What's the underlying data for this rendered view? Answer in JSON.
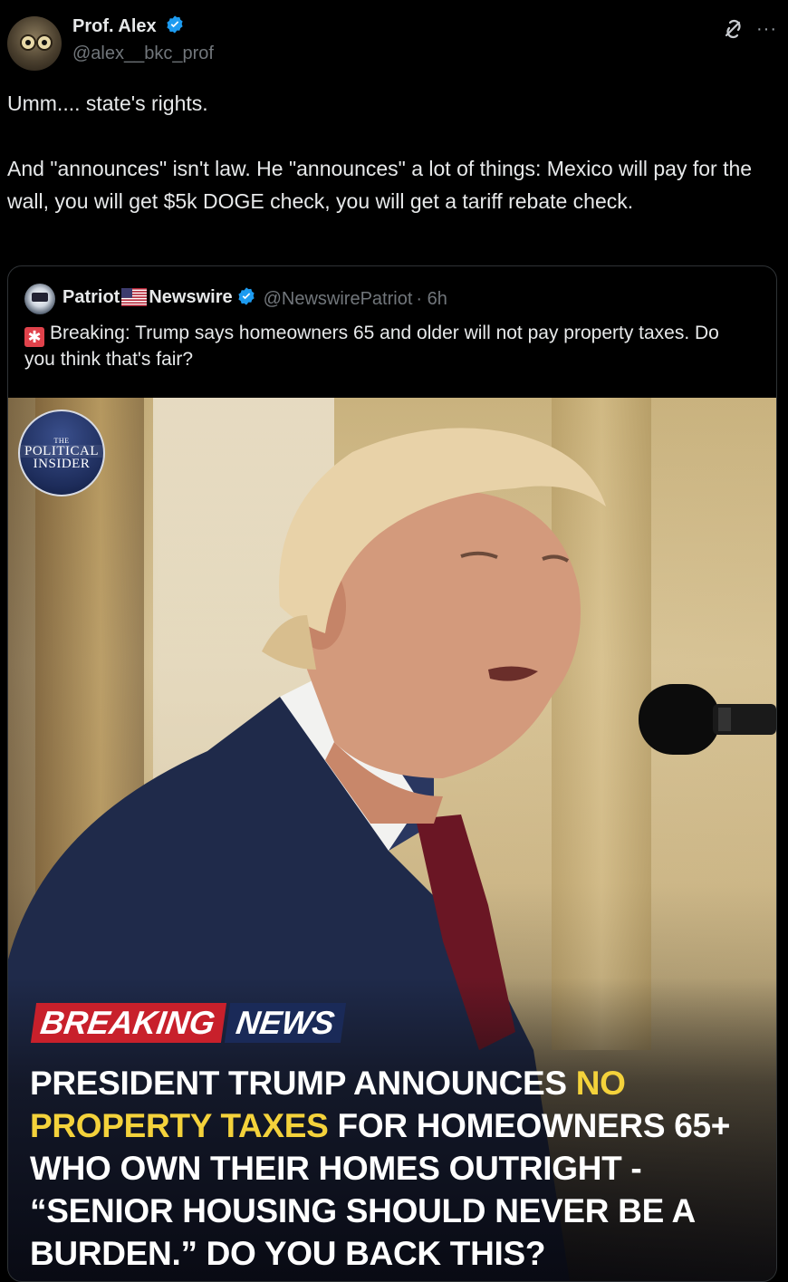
{
  "post": {
    "author_name": "Prof. Alex",
    "author_handle": "@alex__bkc_prof",
    "text_line1": "Umm.... state's rights.",
    "text_line2": "And \"announces\" isn't law. He \"announces\" a lot of things: Mexico will pay for the wall, you will get $5k DOGE check, you will get a tariff rebate check.",
    "more_label": "···"
  },
  "quote": {
    "author_name_part1": "Patriot",
    "author_name_part2": "Newswire",
    "author_handle": "@NewswirePatriot",
    "time": "· 6h",
    "text": "Breaking: Trump says homeowners 65 and older will not pay property taxes. Do you think that's fair?",
    "siren_glyph": "✱"
  },
  "image": {
    "badge_line1": "THE",
    "badge_line2": "POLITICAL",
    "badge_line3": "INSIDER",
    "breaking_label": "BREAKING",
    "news_label": "NEWS",
    "headline_part1": "PRESIDENT TRUMP ANNOUNCES ",
    "headline_yellow1": "NO PROPERTY TAXES",
    "headline_part2": " FOR HOMEOWNERS 65+ WHO OWN THEIR HOMES OUTRIGHT - “SENIOR HOUSING SHOULD NEVER BE A BURDEN.” DO YOU BACK THIS?"
  },
  "colors": {
    "background": "#000000",
    "text_primary": "#e7e9ea",
    "text_secondary": "#71767b",
    "verified_blue": "#1d9bf0",
    "breaking_red": "#c8202b",
    "news_blue": "#1a2a58",
    "headline_yellow": "#f4d23b"
  },
  "icons": [
    "verified-badge-icon",
    "grok-icon",
    "more-icon",
    "us-flag-icon",
    "siren-icon",
    "microphone"
  ]
}
